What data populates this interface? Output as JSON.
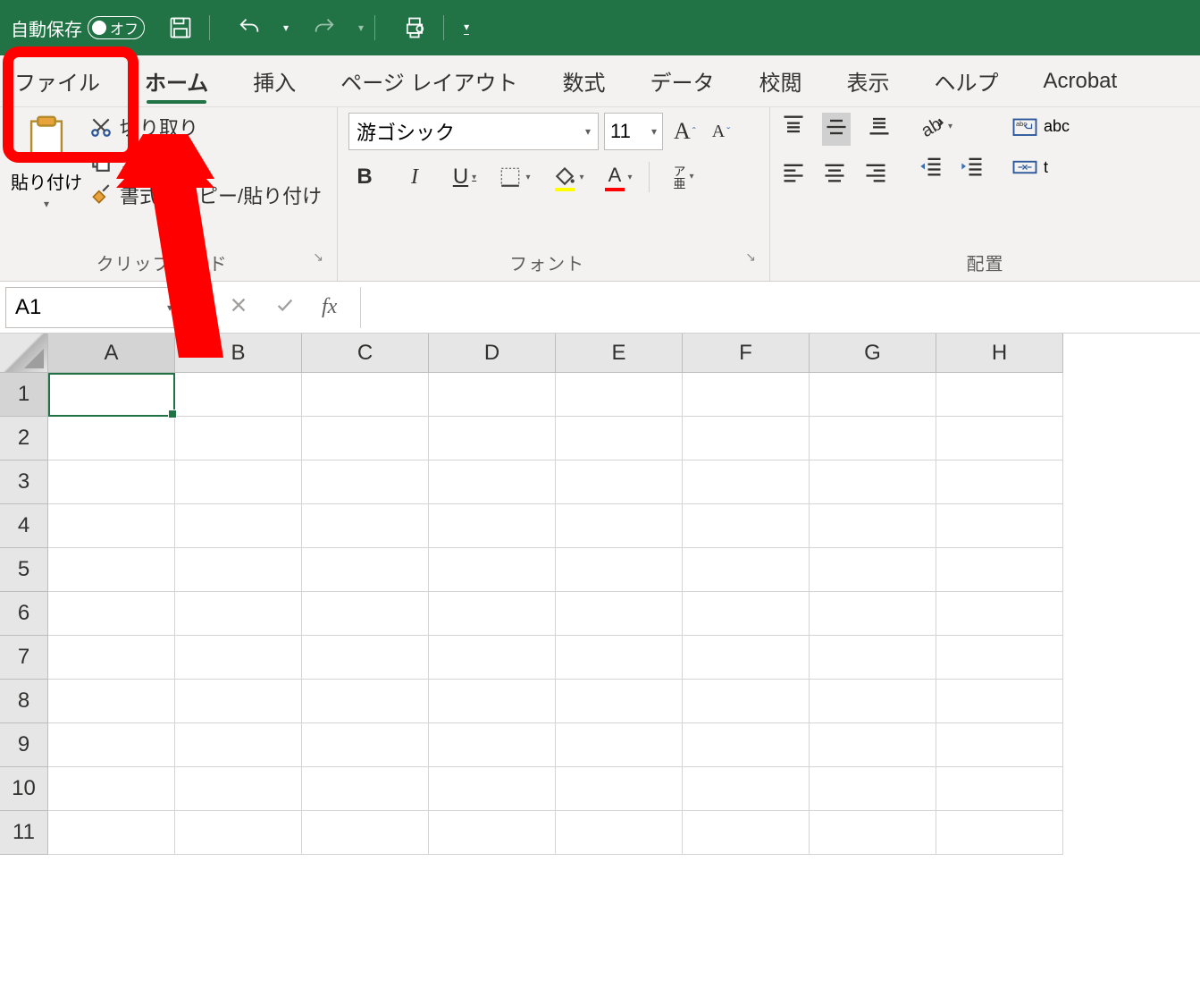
{
  "titlebar": {
    "autosave_label": "自動保存",
    "autosave_state": "オフ"
  },
  "tabs": {
    "file": "ファイル",
    "home": "ホーム",
    "insert": "挿入",
    "page_layout": "ページ レイアウト",
    "formulas": "数式",
    "data": "データ",
    "review": "校閲",
    "view": "表示",
    "help": "ヘルプ",
    "acrobat": "Acrobat"
  },
  "clipboard": {
    "group_label": "クリップボード",
    "paste": "貼り付け",
    "cut": "切り取り",
    "copy": "コピー",
    "format_painter": "書式のコピー/貼り付け"
  },
  "font": {
    "group_label": "フォント",
    "name": "游ゴシック",
    "size": "11",
    "ruby": "ア亜"
  },
  "alignment": {
    "group_label": "配置"
  },
  "wrap_replace_hint": "abc",
  "namebox": "A1",
  "fx_label": "fx",
  "formula_value": "",
  "columns": [
    "A",
    "B",
    "C",
    "D",
    "E",
    "F",
    "G",
    "H"
  ],
  "rows": [
    "1",
    "2",
    "3",
    "4",
    "5",
    "6",
    "7",
    "8",
    "9",
    "10",
    "11"
  ]
}
